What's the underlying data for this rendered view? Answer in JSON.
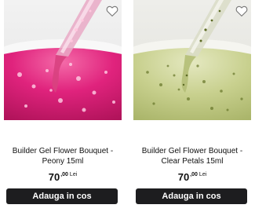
{
  "products": [
    {
      "title_line1": "Builder Gel Flower Bouquet -",
      "title_line2": "Peony 15ml",
      "price_int": "70",
      "price_dec": ",00",
      "currency": "Lei",
      "button_label": "Adauga in cos",
      "gel_color": "#e0237d",
      "icon": "heart-icon"
    },
    {
      "title_line1": "Builder Gel Flower Bouquet -",
      "title_line2": "Clear Petals 15ml",
      "price_int": "70",
      "price_dec": ",00",
      "currency": "Lei",
      "button_label": "Adauga in cos",
      "gel_color": "#c8d08e",
      "icon": "heart-icon"
    }
  ]
}
